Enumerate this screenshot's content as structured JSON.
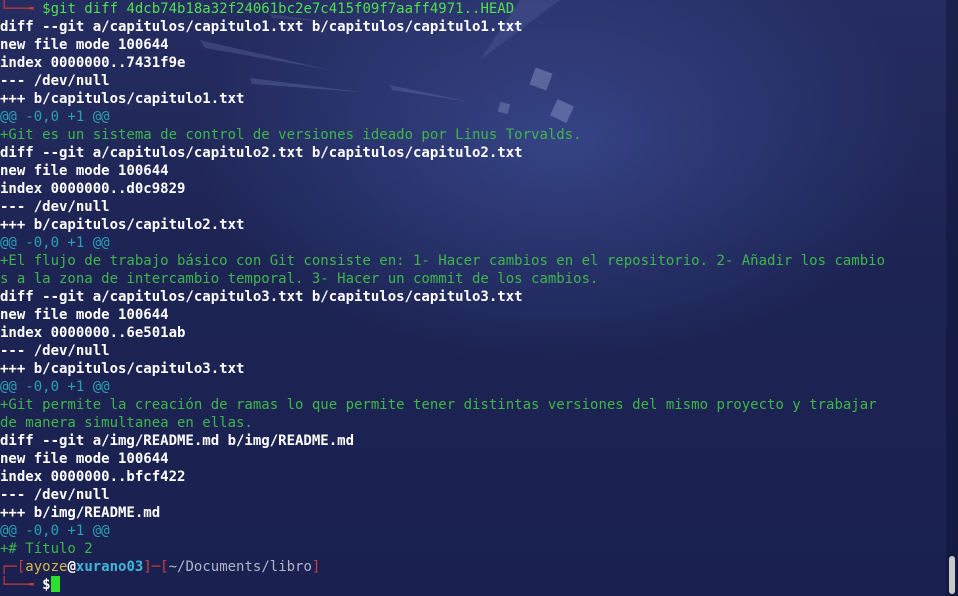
{
  "terminal": {
    "lines": [
      {
        "prefix": "└──╼ ",
        "cmd": "$git diff 4dcb74b18a32f24061bc2e7c415f09f7aaff4971..HEAD"
      },
      {
        "text": "diff --git a/capitulos/capitulo1.txt b/capitulos/capitulo1.txt"
      },
      {
        "text": "new file mode 100644"
      },
      {
        "text": "index 0000000..7431f9e"
      },
      {
        "text": "--- /dev/null"
      },
      {
        "text": "+++ b/capitulos/capitulo1.txt"
      },
      {
        "text": "@@ -0,0 +1 @@"
      },
      {
        "text": "+Git es un sistema de control de versiones ideado por Linus Torvalds."
      },
      {
        "text": "diff --git a/capitulos/capitulo2.txt b/capitulos/capitulo2.txt"
      },
      {
        "text": "new file mode 100644"
      },
      {
        "text": "index 0000000..d0c9829"
      },
      {
        "text": "--- /dev/null"
      },
      {
        "text": "+++ b/capitulos/capitulo2.txt"
      },
      {
        "text": "@@ -0,0 +1 @@"
      },
      {
        "text": "+El flujo de trabajo básico con Git consiste en: 1- Hacer cambios en el repositorio. 2- Añadir los cambio"
      },
      {
        "text": "s a la zona de intercambio temporal. 3- Hacer un commit de los cambios."
      },
      {
        "text": "diff --git a/capitulos/capitulo3.txt b/capitulos/capitulo3.txt"
      },
      {
        "text": "new file mode 100644"
      },
      {
        "text": "index 0000000..6e501ab"
      },
      {
        "text": "--- /dev/null"
      },
      {
        "text": "+++ b/capitulos/capitulo3.txt"
      },
      {
        "text": "@@ -0,0 +1 @@"
      },
      {
        "text": "+Git permite la creación de ramas lo que permite tener distintas versiones del mismo proyecto y trabajar"
      },
      {
        "text": "de manera simultanea en ellas."
      },
      {
        "text": "diff --git a/img/README.md b/img/README.md"
      },
      {
        "text": "new file mode 100644"
      },
      {
        "text": "index 0000000..bfcf422"
      },
      {
        "text": "--- /dev/null"
      },
      {
        "text": "+++ b/img/README.md"
      },
      {
        "text": "@@ -0,0 +1 @@"
      },
      {
        "text": "+# Título 2"
      }
    ],
    "prompt": {
      "corner": "┌─[",
      "user": "ayoze",
      "at": "@",
      "host": "xurano03",
      "sep": "]─[",
      "path": "~/Documents/libro",
      "end": "]",
      "second_prefix": "└──╼ ",
      "symbol": "$"
    }
  },
  "colors": {
    "background": "#1c2350",
    "diff_header": "#ffffff",
    "hunk_header": "#2aa1b3",
    "added_line": "#3fb64a",
    "prompt_frame": "#d23a3a",
    "username": "#d4b84a",
    "hostname": "#3fb8d8",
    "cursor": "#2ee02e"
  }
}
